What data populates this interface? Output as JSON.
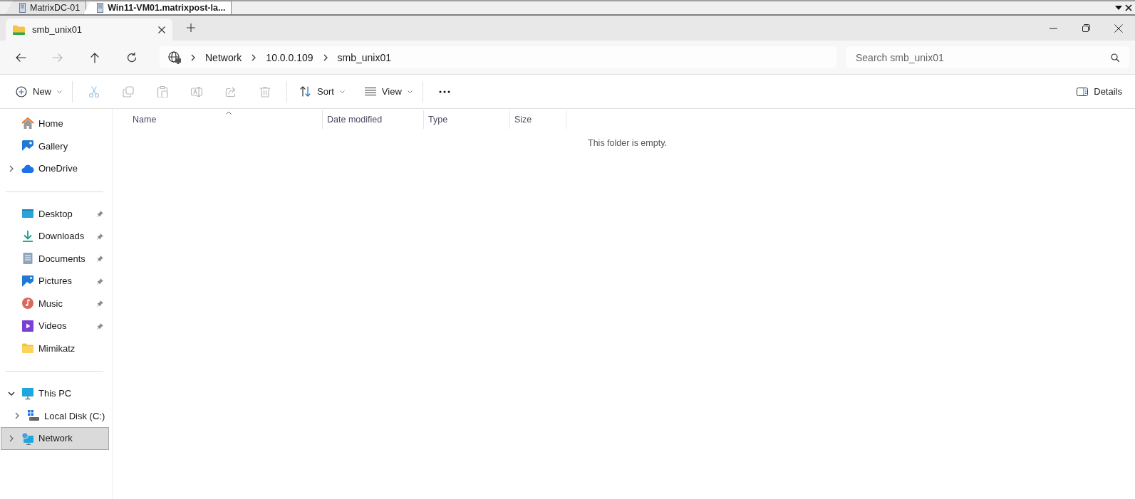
{
  "remote_tabs": [
    {
      "label": "MatrixDC-01",
      "selected": false
    },
    {
      "label": "Win11-VM01.matrixpost-la...",
      "selected": true
    }
  ],
  "window": {
    "tabs": [
      {
        "title": "smb_unix01",
        "selected": true
      }
    ]
  },
  "navigation": {
    "back": {
      "disabled": false
    },
    "forward": {
      "disabled": true
    },
    "up": {
      "disabled": false
    },
    "refresh": {
      "disabled": false
    }
  },
  "address_bar": {
    "crumbs": [
      "Network",
      "10.0.0.109",
      "smb_unix01"
    ]
  },
  "search": {
    "placeholder": "Search smb_unix01"
  },
  "toolbar": {
    "new": {
      "label": "New"
    },
    "actions": [
      {
        "kind": "cut",
        "disabled": true
      },
      {
        "kind": "copy",
        "disabled": true
      },
      {
        "kind": "paste",
        "disabled": true
      },
      {
        "kind": "rename",
        "disabled": true
      },
      {
        "kind": "share",
        "disabled": true
      },
      {
        "kind": "delete",
        "disabled": true
      }
    ],
    "sort": {
      "label": "Sort"
    },
    "view": {
      "label": "View"
    },
    "details": {
      "label": "Details"
    }
  },
  "sidebar": {
    "groups": [
      {
        "items": [
          {
            "label": "Home",
            "kind": "home",
            "selected": false
          },
          {
            "label": "Gallery",
            "kind": "gallery",
            "selected": false
          },
          {
            "label": "OneDrive",
            "kind": "cloud",
            "selected": false,
            "expanded": false
          }
        ]
      },
      {
        "items": [
          {
            "label": "Desktop",
            "kind": "desktop",
            "pinned": true,
            "selected": false
          },
          {
            "label": "Downloads",
            "kind": "download",
            "pinned": true,
            "selected": false
          },
          {
            "label": "Documents",
            "kind": "document",
            "pinned": true,
            "selected": false
          },
          {
            "label": "Pictures",
            "kind": "pictures",
            "pinned": true,
            "selected": false
          },
          {
            "label": "Music",
            "kind": "music",
            "pinned": true,
            "selected": false
          },
          {
            "label": "Videos",
            "kind": "video",
            "pinned": true,
            "selected": false
          },
          {
            "label": "Mimikatz",
            "kind": "folder",
            "pinned": false,
            "selected": false
          }
        ]
      },
      {
        "items": [
          {
            "label": "This PC",
            "kind": "monitor",
            "selected": false,
            "expanded": true,
            "children": [
              {
                "label": "Local Disk (C:)",
                "kind": "disk",
                "selected": false,
                "expanded": false
              }
            ]
          },
          {
            "label": "Network",
            "kind": "network",
            "selected": true,
            "expanded": false
          }
        ]
      }
    ]
  },
  "file_list": {
    "columns": [
      {
        "label": "Name",
        "sorted": true
      },
      {
        "label": "Date modified",
        "sorted": false
      },
      {
        "label": "Type",
        "sorted": false
      },
      {
        "label": "Size",
        "sorted": false
      }
    ],
    "empty_message": "This folder is empty."
  }
}
